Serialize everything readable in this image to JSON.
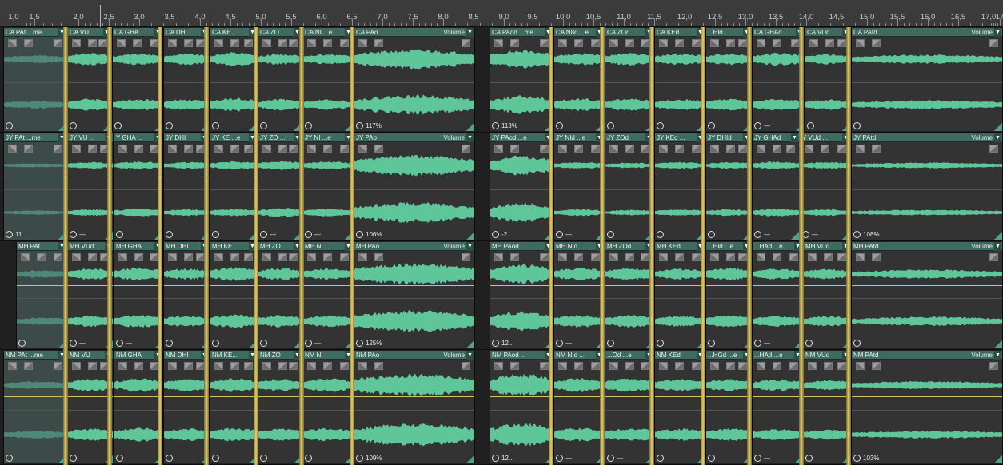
{
  "ruler": {
    "ticks": [
      "1,0",
      "1,5",
      "2,0",
      "2,5",
      "3,0",
      "3,5",
      "4,0",
      "4,5",
      "5,0",
      "5,5",
      "6,0",
      "6,5",
      "7,0",
      "7,5",
      "8,0",
      "8,5",
      "9,0",
      "9,5",
      "10,0",
      "10,5",
      "11,0",
      "11,5",
      "12,0",
      "12,5",
      "13,0",
      "13,5",
      "14,0",
      "14,5",
      "15,0",
      "15,5",
      "16,0",
      "16,5",
      "17,0",
      "17"
    ]
  },
  "colors": {
    "waveform": "#5fc69a",
    "clip_header": "#3e6a60",
    "gain_line": "#d6c35e",
    "marker": "#e6d27a"
  },
  "tracks": [
    {
      "id": "track-ca",
      "clips": [
        {
          "label": "CA PAt ...me",
          "selected": true,
          "footer": ""
        },
        {
          "label": "CA VU...",
          "footer": ""
        },
        {
          "label": "CA GHA...",
          "footer": ""
        },
        {
          "label": "CA DHI",
          "footer": ""
        },
        {
          "label": "CA KE...",
          "footer": ""
        },
        {
          "label": "CA ZO",
          "footer": ""
        },
        {
          "label": "CA NI ...e",
          "footer": ""
        },
        {
          "label": "CA PAo",
          "volume": "Volume",
          "footer": "117%"
        },
        {
          "label": "CA PAod ...me",
          "footer": "113%"
        },
        {
          "label": "CA N8d ...e",
          "footer": ""
        },
        {
          "label": "CA ZOd",
          "footer": ""
        },
        {
          "label": "CA KEd...",
          "footer": ""
        },
        {
          "label": "...Hld ...",
          "footer": ""
        },
        {
          "label": "CA GHAd",
          "footer": "—"
        },
        {
          "label": "CA VUd",
          "footer": ""
        },
        {
          "label": "CA PAtd",
          "volume": "Volume",
          "footer": ""
        }
      ]
    },
    {
      "id": "track-jy",
      "clips": [
        {
          "label": "JY PAt ...me",
          "selected": true,
          "footer": "11..."
        },
        {
          "label": "JY VU ...",
          "footer": "—"
        },
        {
          "label": "Y GHA ...",
          "footer": ""
        },
        {
          "label": "JY DHI",
          "footer": ""
        },
        {
          "label": "JY KE ...e",
          "footer": ""
        },
        {
          "label": "JY ZO ...",
          "footer": "—"
        },
        {
          "label": "JY NI ...e",
          "footer": "—"
        },
        {
          "label": "JY PAo",
          "volume": "Volume",
          "footer": "106%"
        },
        {
          "label": "JY PAod ...e",
          "footer": "-2 ..."
        },
        {
          "label": "JY NId ...e",
          "footer": "—"
        },
        {
          "label": "JY ZOd",
          "footer": ""
        },
        {
          "label": "JY KEd ...",
          "footer": ""
        },
        {
          "label": "JY DHId",
          "footer": ""
        },
        {
          "label": "JY GHAd",
          "footer": "—"
        },
        {
          "label": "Y VUd ...",
          "footer": "—"
        },
        {
          "label": "JY PAtd",
          "volume": "Volume",
          "footer": "108%"
        }
      ]
    },
    {
      "id": "track-mh",
      "clips": [
        {
          "label": "MH PAt",
          "selected": true,
          "footer": ""
        },
        {
          "label": "MH VUd",
          "footer": "—"
        },
        {
          "label": "MH GHA",
          "footer": "—"
        },
        {
          "label": "MH DHI",
          "footer": ""
        },
        {
          "label": "MH KE ...",
          "footer": ""
        },
        {
          "label": "MH ZO",
          "footer": ""
        },
        {
          "label": "MH NI ...",
          "footer": "—"
        },
        {
          "label": "MH PAo",
          "volume": "Volume",
          "footer": "125%"
        },
        {
          "label": "MH PAod ...",
          "footer": "12..."
        },
        {
          "label": "MH NId ...",
          "footer": "—"
        },
        {
          "label": "MH ZOd",
          "footer": ""
        },
        {
          "label": "MH KEd",
          "footer": ""
        },
        {
          "label": "...Hld ...e",
          "footer": ""
        },
        {
          "label": "...HAd ...e",
          "footer": "—"
        },
        {
          "label": "MH VUd",
          "footer": ""
        },
        {
          "label": "MH PAtd",
          "volume": "Volume",
          "footer": ""
        }
      ]
    },
    {
      "id": "track-nm",
      "clips": [
        {
          "label": "NM PAt ...me",
          "selected": true,
          "footer": ""
        },
        {
          "label": "NM VU",
          "footer": ""
        },
        {
          "label": "NM GHA",
          "footer": ""
        },
        {
          "label": "NM DHI",
          "footer": ""
        },
        {
          "label": "NM KE...",
          "footer": ""
        },
        {
          "label": "NM ZO",
          "footer": ""
        },
        {
          "label": "NM NI",
          "footer": ""
        },
        {
          "label": "NM PAo",
          "volume": "Volume",
          "footer": "109%"
        },
        {
          "label": "NM PAod ...",
          "footer": "12..."
        },
        {
          "label": "NM NId ...",
          "footer": "—"
        },
        {
          "label": "...Od ...e",
          "footer": "—"
        },
        {
          "label": "NM KEd",
          "footer": ""
        },
        {
          "label": "...HGd ...e",
          "footer": ""
        },
        {
          "label": "...HAd ...e",
          "footer": "—"
        },
        {
          "label": "NM VUd",
          "footer": ""
        },
        {
          "label": "NM PAtd",
          "volume": "Volume",
          "footer": "103%"
        }
      ]
    }
  ]
}
